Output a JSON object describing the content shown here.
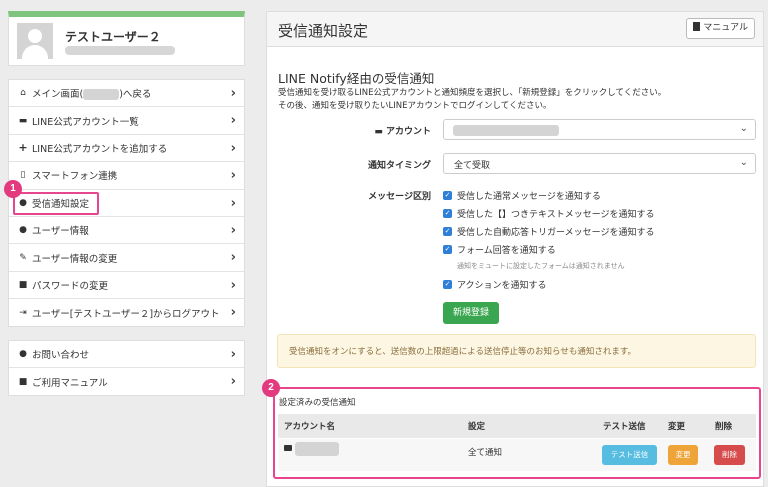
{
  "sidebar": {
    "profile": {
      "name": "テストユーザー２"
    },
    "menu_main": [
      {
        "icon": "home-icon",
        "prefix": "メイン画面(",
        "suffix": ")へ戻る"
      },
      {
        "icon": "chat-icon",
        "label": "LINE公式アカウント一覧"
      },
      {
        "icon": "plus-icon",
        "label": "LINE公式アカウントを追加する"
      },
      {
        "icon": "smartphone-icon",
        "label": "スマートフォン連携"
      },
      {
        "icon": "alert-icon",
        "label": "受信通知設定"
      },
      {
        "icon": "user-icon",
        "label": "ユーザー情報"
      },
      {
        "icon": "pencil-icon",
        "label": "ユーザー情報の変更"
      },
      {
        "icon": "lock-icon",
        "label": "パスワードの変更"
      },
      {
        "icon": "logout-icon",
        "label": "ユーザー[テストユーザー２]からログアウト"
      }
    ],
    "menu_help": [
      {
        "icon": "question-icon",
        "label": "お問い合わせ"
      },
      {
        "icon": "book-icon",
        "label": "ご利用マニュアル"
      }
    ]
  },
  "badges": {
    "first": "1",
    "second": "2"
  },
  "main": {
    "title": "受信通知設定",
    "manual_button": "マニュアル",
    "section_title": "LINE Notify経由の受信通知",
    "description_line1": "受信通知を受け取るLINE公式アカウントと通知頻度を選択し、「新規登録」をクリックしてください。",
    "description_line2": "その後、通知を受け取りたいLINEアカウントでログインしてください。",
    "form": {
      "account_label": "アカウント",
      "timing_label": "通知タイミング",
      "timing_value": "全て受取",
      "message_label": "メッセージ区別",
      "checkboxes": [
        "受信した通常メッセージを通知する",
        "受信した【】つきテキストメッセージを通知する",
        "受信した自動応答トリガーメッセージを通知する",
        "フォーム回答を通知する",
        "アクションを通知する"
      ],
      "form_note": "通知をミュートに設定したフォームは通知されません",
      "register_button": "新規登録"
    },
    "notice": "受信通知をオンにすると、送信数の上限超過による送信停止等のお知らせも通知されます。",
    "registered": {
      "title": "設定済みの受信通知",
      "columns": [
        "アカウント名",
        "設定",
        "テスト送信",
        "変更",
        "削除"
      ],
      "rows": [
        {
          "setting": "全て通知",
          "test": "テスト送信",
          "edit": "変更",
          "delete": "削除"
        }
      ]
    }
  },
  "colors": {
    "profile_accent": "#7fc47c",
    "highlight": "#e8458f",
    "green_button": "#3aa64f",
    "checkbox": "#2f7fd8",
    "test_button": "#56bde0",
    "edit_button": "#efa43a",
    "delete_button": "#d64b4b",
    "notice_bg": "#fcf6e3"
  }
}
